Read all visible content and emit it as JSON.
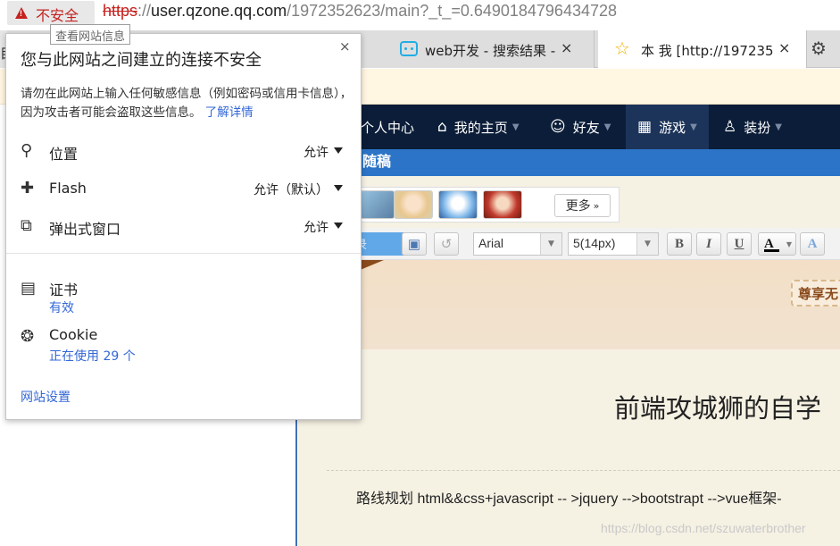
{
  "address_bar": {
    "security_label": "不安全",
    "url_scheme": "https",
    "url_sep": "://",
    "url_host": "user.qzone.qq.com",
    "url_path": "/1972352623/main?_t_=0.6490184796434728",
    "tooltip": "查看网站信息"
  },
  "tabs": [
    {
      "title": "web开发 - 搜索结果 -",
      "close": "×"
    },
    {
      "title": "本 我 [http://197235",
      "close": "×"
    }
  ],
  "popup": {
    "title": "您与此网站之间建立的连接不安全",
    "close": "×",
    "description": "请勿在此网站上输入任何敏感信息（例如密码或信用卡信息），因为攻击者可能会盗取这些信息。",
    "learn_more": "了解详情",
    "permissions": [
      {
        "label": "位置",
        "value": "允许",
        "icon": "location-pin-icon"
      },
      {
        "label": "Flash",
        "value": "允许（默认）",
        "icon": "puzzle-piece-icon"
      },
      {
        "label": "弹出式窗口",
        "value": "允许",
        "icon": "popup-window-icon"
      }
    ],
    "certificate": {
      "label": "证书",
      "status": "有效"
    },
    "cookie": {
      "label": "Cookie",
      "status": "正在使用 29 个"
    },
    "site_settings": "网站设置"
  },
  "page": {
    "left_cut_text": "目",
    "nav": {
      "personal": "个人中心",
      "home": "我的主页",
      "friends": "好友",
      "games": "游戏",
      "dress": "装扮"
    },
    "subbar_title": "随稿",
    "more_button": "更多",
    "toolbar": {
      "publish": "录",
      "font": "Arial",
      "size": "5(14px)",
      "bold": "B",
      "italic": "I",
      "underline": "U",
      "font_color": "A",
      "bg_color": "A"
    },
    "banner_badge": "尊享无",
    "content_title": "前端攻城狮的自学",
    "content_text": "路线规划   html&&css+javascript   -- >jquery -->bootstrapt -->vue框架-",
    "watermark": "https://blog.csdn.net/szuwaterbrother"
  },
  "colors": {
    "insecure_red": "#c5221f",
    "link_blue": "#3367d6",
    "nav_dark": "#0b1d38",
    "subbar_blue": "#2c74c7"
  }
}
